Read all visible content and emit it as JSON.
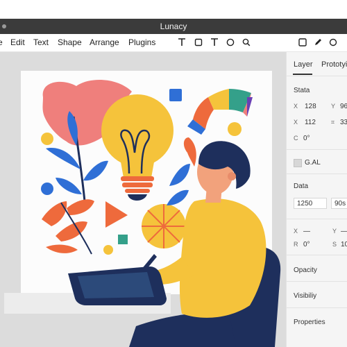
{
  "app": {
    "title": "Lunacy"
  },
  "menu": {
    "items": [
      "e",
      "Edit",
      "Text",
      "Shape",
      "Arrange",
      "Plugins"
    ]
  },
  "toolbar": {
    "left_tools": [
      "text-tool-icon",
      "rectangle-tool-icon",
      "text-tool-icon",
      "ellipse-tool-icon",
      "search-icon"
    ],
    "right_tools": [
      "rectangle-icon",
      "pen-icon",
      "ellipse-icon"
    ]
  },
  "panel": {
    "tabs": [
      "Layer",
      "Prototyi"
    ],
    "stats_title": "Stata",
    "x_key": "X",
    "x_value": "128",
    "y_key": "Y",
    "y_value": "96",
    "x2_key": "X",
    "x2_value": "112",
    "h_key": "⌗",
    "h_value": "33",
    "c_key": "C",
    "c_value": "0°",
    "toggle_label": "G.AL",
    "data_title": "Data",
    "data_field1": "1250",
    "data_field2": "90s",
    "xx_key": "X",
    "xx_value": "—",
    "yy_key": "Y",
    "yy_value": "—",
    "r_key": "R",
    "r_value": "0°",
    "s_key": "S",
    "s_value": "10",
    "opacity_label": "Opacity",
    "visibility_label": "Visibiliy",
    "properties_label": "Properties"
  },
  "colors": {
    "titlebar": "#3b3b3b",
    "canvas_bg": "#dcdcdc",
    "artboard_bg": "#fcfcfc",
    "yellow": "#f5c33b",
    "navy": "#1e2f5c",
    "blue": "#2f6fd6",
    "orange": "#ee6a3c",
    "pink": "#ef7f7c"
  }
}
